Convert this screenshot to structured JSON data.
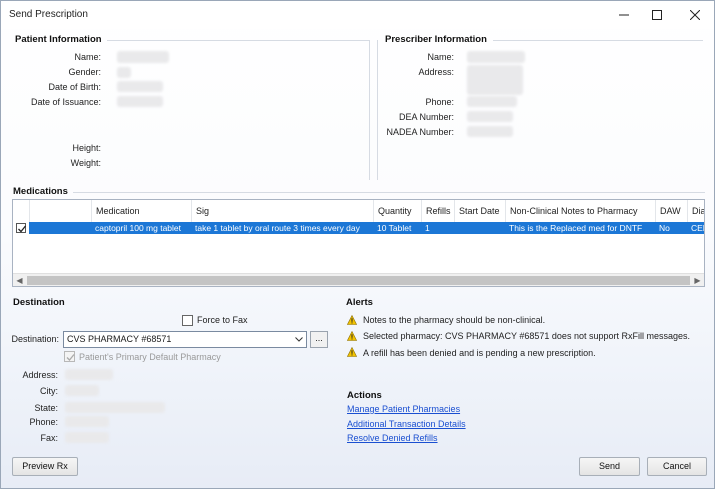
{
  "window": {
    "title": "Send Prescription"
  },
  "patient": {
    "section_title": "Patient Information",
    "labels": {
      "name": "Name:",
      "gender": "Gender:",
      "dob": "Date of Birth:",
      "issuance": "Date of Issuance:",
      "height": "Height:",
      "weight": "Weight:"
    }
  },
  "prescriber": {
    "section_title": "Prescriber Information",
    "labels": {
      "name": "Name:",
      "address": "Address:",
      "phone": "Phone:",
      "dea": "DEA Number:",
      "nadea": "NADEA Number:"
    }
  },
  "medications": {
    "section_title": "Medications",
    "columns": [
      "Medication",
      "Sig",
      "Quantity",
      "Refills",
      "Start Date",
      "Non-Clinical Notes to Pharmacy",
      "DAW",
      "Diagn"
    ],
    "rows": [
      {
        "checked": true,
        "medication": "captopril 100 mg tablet",
        "sig": "take 1 tablet by oral route 3 times every day",
        "quantity": "10 Tablet",
        "refills": "1",
        "start_date": "",
        "notes": "This is the Replaced med for DNTF",
        "daw": "No",
        "diagnosis": "CELL"
      }
    ]
  },
  "destination": {
    "section_title": "Destination",
    "force_fax_label": "Force to Fax",
    "destination_label": "Destination:",
    "destination_value": "CVS PHARMACY #68571",
    "browse_label": "...",
    "primary_default_label": "Patient's Primary Default Pharmacy",
    "labels": {
      "address": "Address:",
      "city": "City:",
      "state": "State:",
      "phone": "Phone:",
      "fax": "Fax:"
    }
  },
  "alerts": {
    "section_title": "Alerts",
    "items": [
      "Notes to the pharmacy should be non-clinical.",
      "Selected pharmacy: CVS PHARMACY #68571 does not support RxFill messages.",
      "A refill has been denied and is pending a new prescription."
    ]
  },
  "actions": {
    "section_title": "Actions",
    "links": [
      "Manage Patient Pharmacies",
      "Additional Transaction Details",
      "Resolve Denied Refills"
    ]
  },
  "buttons": {
    "preview": "Preview Rx",
    "send": "Send",
    "cancel": "Cancel"
  },
  "colors": {
    "selection": "#1c77d6",
    "link": "#1a4fd1",
    "warning": "#f2c200"
  }
}
